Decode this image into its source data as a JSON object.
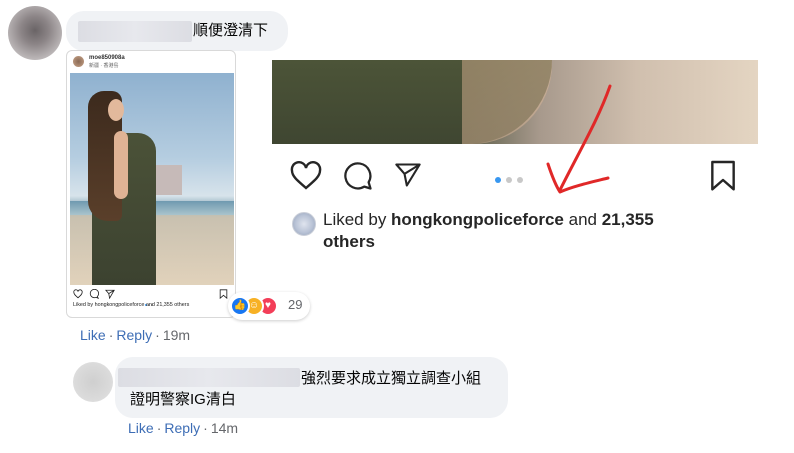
{
  "comments": [
    {
      "text": "順便澄清下",
      "actions": {
        "like": "Like",
        "reply": "Reply",
        "time": "19m"
      },
      "reactions": {
        "count": "29",
        "icons": [
          "like-icon",
          "haha-icon",
          "love-icon"
        ]
      }
    },
    {
      "text_line1": "強烈要求成立獨立調查小組",
      "text_line2": "證明警察IG清白",
      "actions": {
        "like": "Like",
        "reply": "Reply",
        "time": "14m"
      }
    }
  ],
  "instagram_small": {
    "username": "moe850908a",
    "location": "新疆 · 香港島",
    "likes_text": "Liked by hongkongpoliceforce and 21,355 others"
  },
  "instagram_zoom": {
    "liked_prefix": "Liked by ",
    "liked_account": "hongkongpoliceforce",
    "liked_and": " and ",
    "liked_count": "21,355",
    "liked_suffix": "others",
    "carousel_dots": 3,
    "active_dot": 1
  },
  "colors": {
    "link": "#3d6db5",
    "bubble": "#f0f2f5",
    "arrow": "#e02828",
    "carousel_active": "#3897f0"
  }
}
